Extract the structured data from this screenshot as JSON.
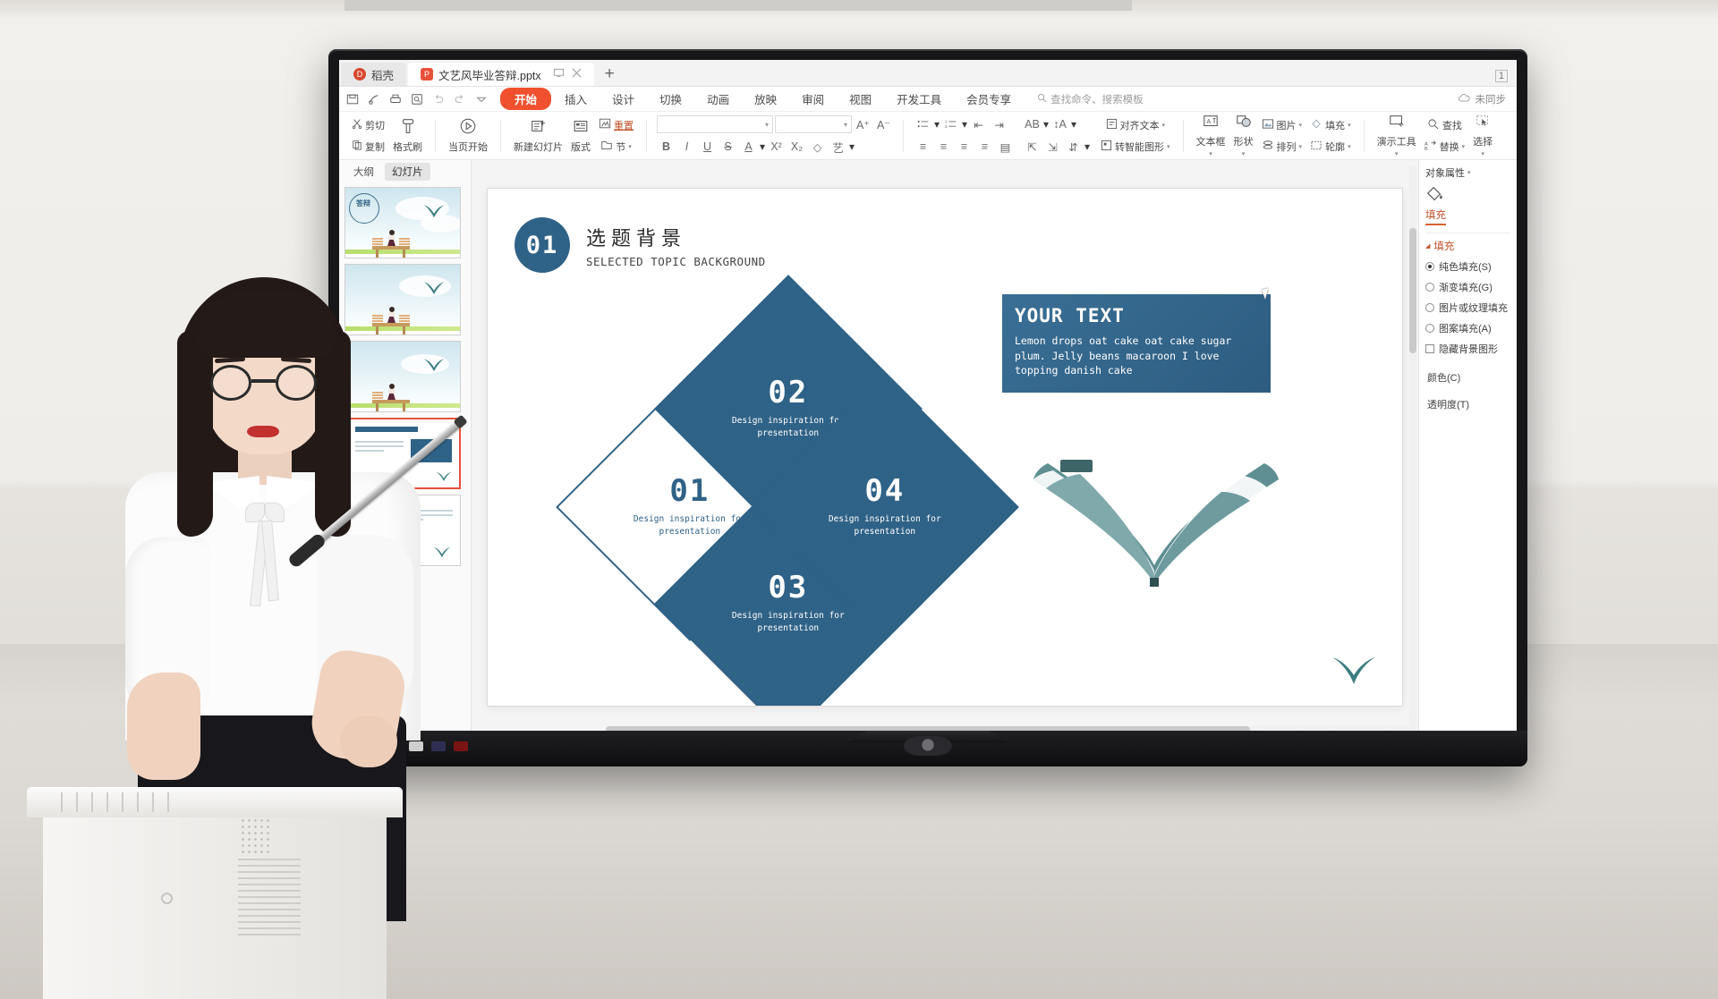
{
  "window": {
    "tabs": [
      {
        "label": "稻壳",
        "icon": "dock-icon"
      },
      {
        "label": "文艺风毕业答辩.pptx",
        "icon": "pptx-icon"
      }
    ],
    "new_tab": "+",
    "restore_label": "1",
    "sync_status": "未同步"
  },
  "ribbon": {
    "quick_access": [
      "save-icon",
      "print-preview-icon",
      "print-icon",
      "search-doc-icon",
      "undo-icon",
      "redo-icon",
      "customize-icon"
    ],
    "tabs": [
      {
        "label": "开始",
        "active": true
      },
      {
        "label": "插入",
        "active": false
      },
      {
        "label": "设计",
        "active": false
      },
      {
        "label": "切换",
        "active": false
      },
      {
        "label": "动画",
        "active": false
      },
      {
        "label": "放映",
        "active": false
      },
      {
        "label": "审阅",
        "active": false
      },
      {
        "label": "视图",
        "active": false
      },
      {
        "label": "开发工具",
        "active": false
      },
      {
        "label": "会员专享",
        "active": false
      }
    ],
    "search_placeholder": "查找命令、搜索模板"
  },
  "toolbar": {
    "cut": "剪切",
    "copy": "复制",
    "format_painter": "格式刷",
    "start_here": "当页开始",
    "new_slide": "新建幻灯片",
    "layout": "版式",
    "section": "节",
    "reset": "重置",
    "font_name": "",
    "font_size": "",
    "grow_font": "A",
    "shrink_font": "A",
    "bold": "B",
    "italic": "I",
    "underline": "U",
    "strike": "S",
    "font_color": "A",
    "superscript": "X²",
    "subscript": "X₂",
    "clear_format": "◇",
    "text_effect": "艺",
    "align_text": "对齐文本",
    "smart_art": "转智能图形",
    "text_box": "文本框",
    "shapes": "形状",
    "picture": "图片",
    "arrange": "排列",
    "fill": "填充",
    "outline": "轮廓",
    "present_tools": "演示工具",
    "find": "查找",
    "replace": "替换",
    "select": "选择"
  },
  "left_panel": {
    "tabs": [
      {
        "label": "大纲",
        "active": false
      },
      {
        "label": "幻灯片",
        "active": true
      }
    ],
    "thumbnails": [
      {
        "index": 1,
        "seal_text": "答辩",
        "selected": false
      },
      {
        "index": 2,
        "selected": false
      },
      {
        "index": 3,
        "selected": false
      },
      {
        "index": 4,
        "selected": true
      },
      {
        "index": 5,
        "selected": false
      }
    ]
  },
  "slide": {
    "badge_number": "01",
    "title_cn": "选题背景",
    "title_en": "SELECTED TOPIC BACKGROUND",
    "diamonds": [
      {
        "number": "01",
        "caption_line1": "Design inspiration for",
        "caption_line2": "presentation",
        "style": "outline"
      },
      {
        "number": "02",
        "caption_line1": "Design inspiration for",
        "caption_line2": "presentation",
        "style": "fill"
      },
      {
        "number": "03",
        "caption_line1": "Design inspiration for",
        "caption_line2": "presentation",
        "style": "fill"
      },
      {
        "number": "04",
        "caption_line1": "Design inspiration for",
        "caption_line2": "presentation",
        "style": "fill"
      }
    ],
    "text_card": {
      "heading": "YOUR TEXT",
      "body": "Lemon drops oat cake oat cake sugar plum. Jelly beans macaroon I love topping danish cake"
    }
  },
  "right_panel": {
    "title": "对象属性",
    "tab": "填充",
    "section": "填充",
    "options": [
      {
        "label": "纯色填充(S)",
        "type": "radio",
        "selected": true
      },
      {
        "label": "渐变填充(G)",
        "type": "radio",
        "selected": false
      },
      {
        "label": "图片或纹理填充",
        "type": "radio",
        "selected": false
      },
      {
        "label": "图案填充(A)",
        "type": "radio",
        "selected": false
      },
      {
        "label": "隐藏背景图形",
        "type": "checkbox",
        "selected": false
      }
    ],
    "color_label": "颜色(C)",
    "transparency_label": "透明度(T)"
  },
  "colors": {
    "accent_blue": "#2f6287",
    "accent_orange": "#f0502e",
    "panel_orange": "#c0502a",
    "slide_bg": "#ffffff"
  }
}
